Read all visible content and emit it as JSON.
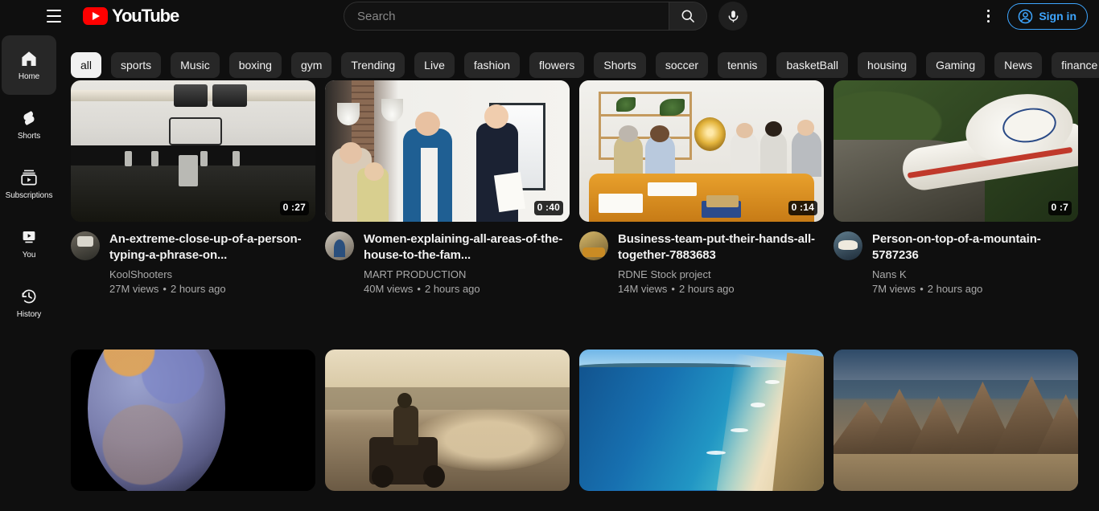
{
  "topbar": {
    "menu_icon": "hamburger-menu-icon",
    "logo_text": "YouTube",
    "logo_icon": "youtube-play-icon",
    "search": {
      "placeholder": "Search",
      "value": "",
      "search_icon": "search-icon",
      "mic_icon": "microphone-icon"
    },
    "kebab_icon": "more-vertical-icon",
    "signin_label": "Sign in",
    "signin_icon": "account-circle-icon",
    "signin_color": "#3ea6ff"
  },
  "sidebar": {
    "items": [
      {
        "label": "Home",
        "icon": "home-icon",
        "active": true
      },
      {
        "label": "Shorts",
        "icon": "shorts-icon",
        "active": false
      },
      {
        "label": "Subscriptions",
        "icon": "subscriptions-icon",
        "active": false
      },
      {
        "label": "You",
        "icon": "you-icon",
        "active": false
      },
      {
        "label": "History",
        "icon": "history-icon",
        "active": false
      }
    ]
  },
  "chips": {
    "active_index": 0,
    "items": [
      "all",
      "sports",
      "Music",
      "boxing",
      "gym",
      "Trending",
      "Live",
      "fashion",
      "flowers",
      "Shorts",
      "soccer",
      "tennis",
      "basketBall",
      "housing",
      "Gaming",
      "News",
      "finance"
    ]
  },
  "videos": [
    {
      "title": "An-extreme-close-up-of-a-person-typing-a-phrase-on...",
      "channel": "KoolShooters",
      "views": "27M views",
      "age": "2 hours ago",
      "duration": "0 :27",
      "scene": "sc-type",
      "avatar_class": "av-kool"
    },
    {
      "title": "Women-explaining-all-areas-of-the-house-to-the-fam...",
      "channel": "MART PRODUCTION",
      "views": "40M views",
      "age": "2 hours ago",
      "duration": "0 :40",
      "scene": "sc-fam",
      "avatar_class": "av-mart"
    },
    {
      "title": "Business-team-put-their-hands-all-together-7883683",
      "channel": "RDNE Stock project",
      "views": "14M views",
      "age": "2 hours ago",
      "duration": "0 :14",
      "scene": "sc-biz",
      "avatar_class": "av-rdne"
    },
    {
      "title": "Person-on-top-of-a-mountain-5787236",
      "channel": "Nans K",
      "views": "7M views",
      "age": "2 hours ago",
      "duration": "0 :7",
      "scene": "sc-shoe",
      "avatar_class": "av-nans"
    },
    {
      "title": "",
      "channel": "",
      "views": "",
      "age": "",
      "duration": "",
      "scene": "sc-planet",
      "avatar_class": ""
    },
    {
      "title": "",
      "channel": "",
      "views": "",
      "age": "",
      "duration": "",
      "scene": "sc-quad",
      "avatar_class": ""
    },
    {
      "title": "",
      "channel": "",
      "views": "",
      "age": "",
      "duration": "",
      "scene": "sc-beach",
      "avatar_class": ""
    },
    {
      "title": "",
      "channel": "",
      "views": "",
      "age": "",
      "duration": "",
      "scene": "sc-mtn",
      "avatar_class": ""
    }
  ],
  "separator_dot": "•"
}
